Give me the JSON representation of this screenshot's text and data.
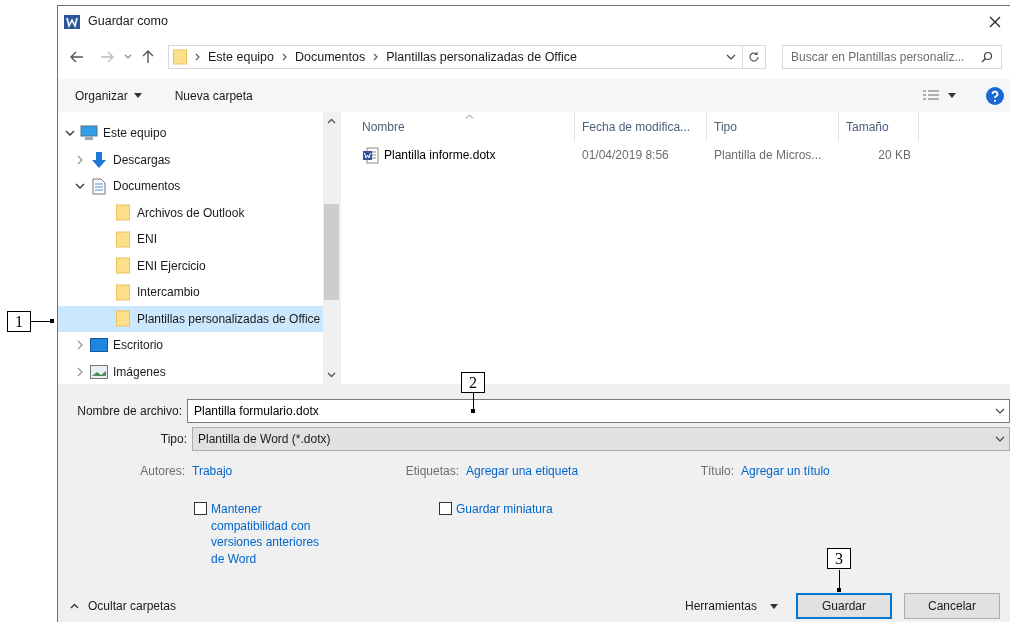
{
  "window": {
    "title": "Guardar como"
  },
  "nav": {
    "breadcrumb": [
      "Este equipo",
      "Documentos",
      "Plantillas personalizadas de Office"
    ],
    "search": {
      "placeholder": "Buscar en Plantillas personaliz..."
    }
  },
  "toolbar": {
    "organize": "Organizar",
    "new_folder": "Nueva carpeta"
  },
  "tree": [
    {
      "label": "Este equipo",
      "kind": "computer",
      "expanded": true,
      "selected": false,
      "children": [
        {
          "label": "Descargas",
          "kind": "download",
          "expanded": false,
          "selected": false
        },
        {
          "label": "Documentos",
          "kind": "document",
          "expanded": true,
          "selected": false,
          "children": [
            {
              "label": "Archivos de Outlook",
              "kind": "folder",
              "selected": false
            },
            {
              "label": "ENI",
              "kind": "folder",
              "selected": false
            },
            {
              "label": "ENI Ejercicio",
              "kind": "folder",
              "selected": false
            },
            {
              "label": "Intercambio",
              "kind": "folder",
              "selected": false
            },
            {
              "label": "Plantillas personalizadas de Office",
              "kind": "folder",
              "selected": true
            }
          ]
        },
        {
          "label": "Escritorio",
          "kind": "desktop",
          "expanded": false,
          "selected": false
        },
        {
          "label": "Imágenes",
          "kind": "pictures",
          "expanded": false,
          "selected": false
        }
      ]
    }
  ],
  "file_list": {
    "columns": [
      {
        "label": "Nombre",
        "sorted": true
      },
      {
        "label": "Fecha de modifica...",
        "sorted": false
      },
      {
        "label": "Tipo",
        "sorted": false
      },
      {
        "label": "Tamaño",
        "sorted": false
      }
    ],
    "rows": [
      {
        "name": "Plantilla informe.dotx",
        "date": "01/04/2019 8:56",
        "type": "Plantilla de Micros...",
        "size": "20 KB"
      }
    ]
  },
  "form": {
    "file_name_label": "Nombre de archivo:",
    "file_name": "Plantilla formulario.dotx",
    "type_label": "Tipo:",
    "type": "Plantilla de Word (*.dotx)",
    "metadata": [
      {
        "label": "Autores:",
        "value": "Trabajo"
      },
      {
        "label": "Etiquetas:",
        "value": "Agregar una etiqueta"
      },
      {
        "label": "Título:",
        "value": "Agregar un título"
      }
    ],
    "options": [
      {
        "label": "Mantener compatibilidad con versiones anteriores de Word",
        "checked": false
      },
      {
        "label": "Guardar miniatura",
        "checked": false
      }
    ]
  },
  "footer": {
    "hide_folders": "Ocultar carpetas",
    "tools": "Herramientas",
    "buttons": [
      {
        "label": "Guardar",
        "default": true
      },
      {
        "label": "Cancelar",
        "default": false
      }
    ]
  },
  "callouts": [
    "1",
    "2",
    "3"
  ]
}
